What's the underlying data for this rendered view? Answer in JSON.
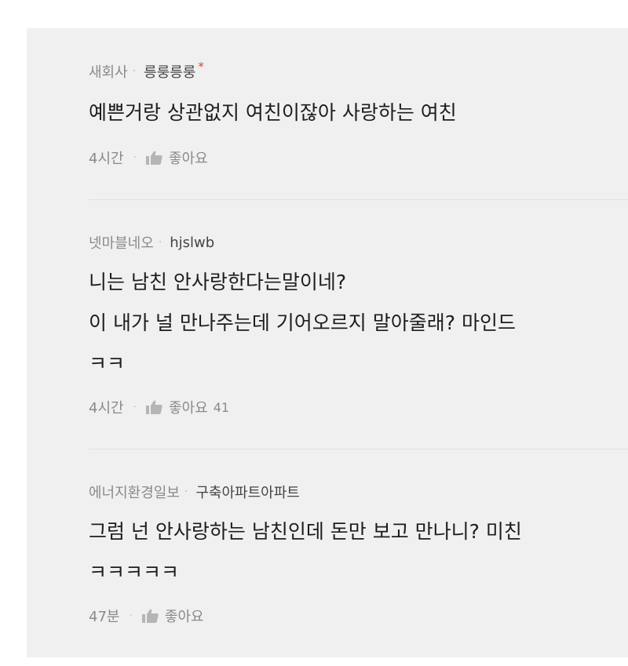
{
  "comments": [
    {
      "author": "새회사",
      "handle": "릉룽릉룽",
      "star": "*",
      "text": "예쁜거랑 상관없지 여친이잖아 사랑하는 여친",
      "time": "4시간",
      "like_label": "좋아요",
      "like_count": ""
    },
    {
      "author": "넷마블네오",
      "handle": "hjslwb",
      "star": "",
      "text": "니는 남친 안사랑한다는말이네?\n이 내가 널 만나주는데 기어오르지 말아줄래? 마인드\nㅋㅋ",
      "time": "4시간",
      "like_label": "좋아요",
      "like_count": "41"
    },
    {
      "author": "에너지환경일보",
      "handle": "구축아파트아파트",
      "star": "",
      "text": "그럼 넌 안사랑하는 남친인데 돈만 보고 만나니? 미친\nㅋㅋㅋㅋㅋ",
      "time": "47분",
      "like_label": "좋아요",
      "like_count": ""
    }
  ],
  "icons": {
    "like": "thumbs-up-icon"
  },
  "colors": {
    "panel": "#f0f0f0",
    "star": "#e0452a",
    "text": "#1d1d1d",
    "muted": "#8a8a8a"
  }
}
